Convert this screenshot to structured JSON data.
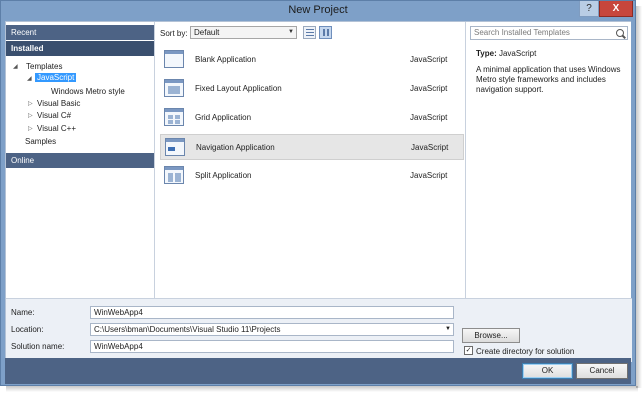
{
  "window": {
    "title": "New Project",
    "help_glyph": "?",
    "close_glyph": "X"
  },
  "left_nav": {
    "recent": "Recent",
    "installed": "Installed",
    "templates": "Templates",
    "javascript": "JavaScript",
    "windows_metro": "Windows Metro style",
    "visual_basic": "Visual Basic",
    "visual_csharp": "Visual C#",
    "visual_cpp": "Visual C++",
    "samples": "Samples",
    "online": "Online"
  },
  "toolbar": {
    "sort_label": "Sort by:",
    "sort_value": "Default"
  },
  "templates": [
    {
      "name": "Blank Application",
      "language": "JavaScript"
    },
    {
      "name": "Fixed Layout Application",
      "language": "JavaScript"
    },
    {
      "name": "Grid Application",
      "language": "JavaScript"
    },
    {
      "name": "Navigation Application",
      "language": "JavaScript"
    },
    {
      "name": "Split Application",
      "language": "JavaScript"
    }
  ],
  "details": {
    "search_placeholder": "Search Installed Templates",
    "type_label": "Type:",
    "type_value": "JavaScript",
    "description": "A minimal application that uses Windows Metro style frameworks and includes navigation support."
  },
  "form": {
    "name_label": "Name:",
    "name_value": "WinWebApp4",
    "location_label": "Location:",
    "location_value": "C:\\Users\\bman\\Documents\\Visual Studio 11\\Projects",
    "solution_label": "Solution name:",
    "solution_value": "WinWebApp4",
    "browse_label": "Browse...",
    "create_dir_label": "Create directory for solution",
    "create_dir_checked": true
  },
  "buttons": {
    "ok": "OK",
    "cancel": "Cancel"
  },
  "colors": {
    "title_blue": "#7ea0c8",
    "nav_header": "#4d6385",
    "selection": "#3399ff"
  }
}
